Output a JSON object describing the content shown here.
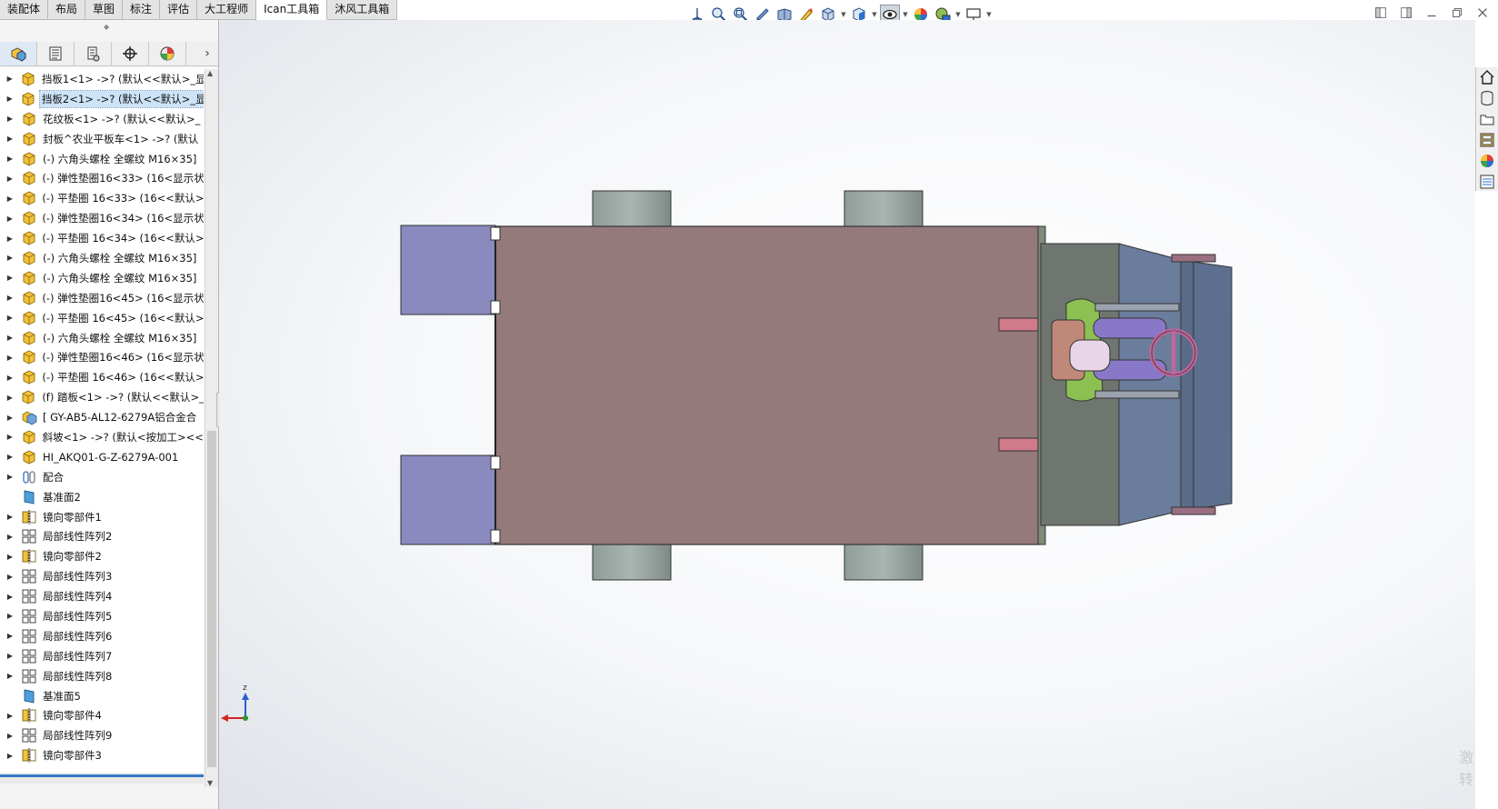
{
  "tabs": [
    "装配体",
    "布局",
    "草图",
    "标注",
    "评估",
    "大工程师",
    "Ican工具箱",
    "沐风工具箱"
  ],
  "active_tab_index": 6,
  "hud_tools": [
    {
      "icon": "view-orientation-icon",
      "dropdown": false
    },
    {
      "icon": "zoom-to-fit-icon",
      "dropdown": false
    },
    {
      "icon": "zoom-to-area-icon",
      "dropdown": false
    },
    {
      "icon": "previous-view-icon",
      "dropdown": false
    },
    {
      "icon": "section-view-icon",
      "dropdown": false
    },
    {
      "icon": "dynamic-annotation-icon",
      "dropdown": false
    },
    {
      "icon": "display-style-icon",
      "dropdown": true
    },
    {
      "icon": "view-orientation-cube-icon",
      "dropdown": true
    },
    {
      "icon": "hide-show-items-icon",
      "dropdown": true,
      "pressed": true
    },
    {
      "icon": "edit-appearance-icon",
      "dropdown": false
    },
    {
      "icon": "apply-scene-icon",
      "dropdown": true
    },
    {
      "icon": "view-settings-icon",
      "dropdown": true
    }
  ],
  "window_controls": [
    "tile-left-icon",
    "tile-right-icon",
    "minimize-icon",
    "restore-icon",
    "close-icon"
  ],
  "manager_tabs": [
    "featuremanager-icon",
    "propertymanager-icon",
    "configurationmanager-icon",
    "dimxpertmanager-icon",
    "displaymanager-icon"
  ],
  "filter_icon": "filter-icon",
  "tree": [
    {
      "label": "挡板1<1> ->? (默认<<默认>_显",
      "icon": "part-icon",
      "expandable": true
    },
    {
      "label": "挡板2<1> ->? (默认<<默认>_显",
      "icon": "part-icon",
      "expandable": true,
      "selected": true
    },
    {
      "label": "花纹板<1> ->? (默认<<默认>_",
      "icon": "part-icon",
      "expandable": true
    },
    {
      "label": "封板^农业平板车<1> ->? (默认",
      "icon": "part-icon",
      "expandable": true
    },
    {
      "label": "(-) 六角头螺栓 全螺纹 M16×35]",
      "icon": "part-icon",
      "expandable": true
    },
    {
      "label": "(-) 弹性垫圈16<33> (16<显示状",
      "icon": "part-icon",
      "expandable": true
    },
    {
      "label": "(-) 平垫圈 16<33> (16<<默认>",
      "icon": "part-icon",
      "expandable": true
    },
    {
      "label": "(-) 弹性垫圈16<34> (16<显示状",
      "icon": "part-icon",
      "expandable": true
    },
    {
      "label": "(-) 平垫圈 16<34> (16<<默认>",
      "icon": "part-icon",
      "expandable": true
    },
    {
      "label": "(-) 六角头螺栓 全螺纹 M16×35]",
      "icon": "part-icon",
      "expandable": true
    },
    {
      "label": "(-) 六角头螺栓 全螺纹 M16×35]",
      "icon": "part-icon",
      "expandable": true
    },
    {
      "label": "(-) 弹性垫圈16<45> (16<显示状",
      "icon": "part-icon",
      "expandable": true
    },
    {
      "label": "(-) 平垫圈 16<45> (16<<默认>",
      "icon": "part-icon",
      "expandable": true
    },
    {
      "label": "(-) 六角头螺栓 全螺纹 M16×35]",
      "icon": "part-icon",
      "expandable": true
    },
    {
      "label": "(-) 弹性垫圈16<46> (16<显示状",
      "icon": "part-icon",
      "expandable": true
    },
    {
      "label": "(-) 平垫圈 16<46> (16<<默认>",
      "icon": "part-icon",
      "expandable": true
    },
    {
      "label": "(f) 踏板<1> ->? (默认<<默认>_",
      "icon": "part-icon",
      "expandable": true
    },
    {
      "label": "[ GY-AB5-AL12-6279A铝合金合",
      "icon": "assembly-icon",
      "expandable": true
    },
    {
      "label": "斜坡<1> ->? (默认<按加工><<",
      "icon": "part-icon",
      "expandable": true
    },
    {
      "label": "HI_AKQ01-G-Z-6279A-001",
      "icon": "part-icon",
      "expandable": true
    },
    {
      "label": "配合",
      "icon": "mates-icon",
      "expandable": true
    },
    {
      "label": "基准面2",
      "icon": "plane-icon",
      "expandable": false
    },
    {
      "label": "镜向零部件1",
      "icon": "mirror-component-icon",
      "expandable": true
    },
    {
      "label": "局部线性阵列2",
      "icon": "linear-pattern-icon",
      "expandable": true
    },
    {
      "label": "镜向零部件2",
      "icon": "mirror-component-icon",
      "expandable": true
    },
    {
      "label": "局部线性阵列3",
      "icon": "linear-pattern-icon",
      "expandable": true
    },
    {
      "label": "局部线性阵列4",
      "icon": "linear-pattern-icon",
      "expandable": true
    },
    {
      "label": "局部线性阵列5",
      "icon": "linear-pattern-icon",
      "expandable": true
    },
    {
      "label": "局部线性阵列6",
      "icon": "linear-pattern-icon",
      "expandable": true
    },
    {
      "label": "局部线性阵列7",
      "icon": "linear-pattern-icon",
      "expandable": true
    },
    {
      "label": "局部线性阵列8",
      "icon": "linear-pattern-icon",
      "expandable": true
    },
    {
      "label": "基准面5",
      "icon": "plane-icon",
      "expandable": false
    },
    {
      "label": "镜向零部件4",
      "icon": "mirror-component-icon",
      "expandable": true
    },
    {
      "label": "局部线性阵列9",
      "icon": "linear-pattern-icon",
      "expandable": true
    },
    {
      "label": "镜向零部件3",
      "icon": "mirror-component-icon",
      "expandable": true
    }
  ],
  "triad": {
    "x_label": "x",
    "z_label": "z"
  },
  "watermark": [
    "激",
    "转"
  ],
  "task_pane": [
    "home-icon",
    "design-library-icon",
    "file-explorer-icon",
    "view-palette-icon",
    "appearances-icon",
    "custom-properties-icon"
  ],
  "colors": {
    "deck": "#957a7b",
    "side_panel": "#8a8abf",
    "wheel": "#9eaaa6",
    "cab_dark": "#6f7670",
    "cab_blue": "#6b7d9c",
    "seat_purple": "#8878c8",
    "steering_wheel": "#c2669b",
    "selection": "#cde3f7"
  }
}
